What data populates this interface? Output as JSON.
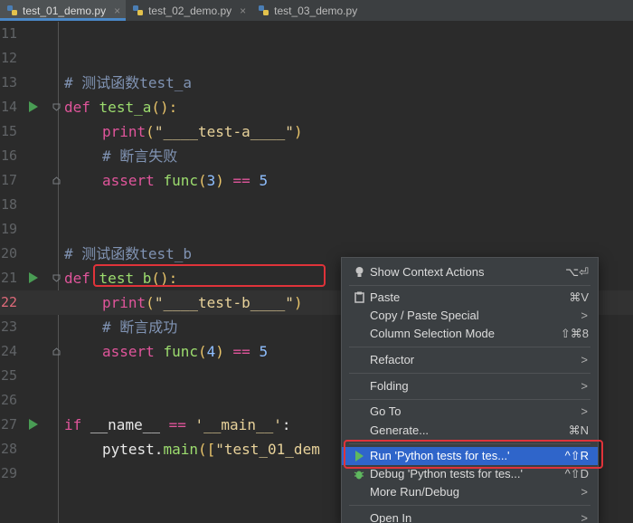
{
  "tabs": [
    {
      "label": "test_01_demo.py",
      "active": true
    },
    {
      "label": "test_02_demo.py",
      "active": false
    },
    {
      "label": "test_03_demo.py",
      "active": false
    }
  ],
  "tab_close_glyph": "×",
  "lines": [
    {
      "num": "11"
    },
    {
      "num": "12"
    },
    {
      "num": "13",
      "comment": "# 测试函数test_a"
    },
    {
      "num": "14",
      "kw": "def",
      "name": "test_a",
      "tail": "():"
    },
    {
      "num": "15",
      "call": "print",
      "open": "(",
      "str": "\"____test-a____\"",
      "close": ")"
    },
    {
      "num": "16",
      "comment": "# 断言失败"
    },
    {
      "num": "17",
      "assert": "assert",
      "fn": "func",
      "open": "(",
      "arg": "3",
      "close": ")",
      "op": "==",
      "rhs": "5"
    },
    {
      "num": "18"
    },
    {
      "num": "19"
    },
    {
      "num": "20",
      "comment": "# 测试函数test_b"
    },
    {
      "num": "21",
      "kw": "def",
      "name": "test_b",
      "tail": "():"
    },
    {
      "num": "22",
      "call": "print",
      "open": "(",
      "str": "\"____test-b____\"",
      "close": ")"
    },
    {
      "num": "23",
      "comment": "# 断言成功"
    },
    {
      "num": "24",
      "assert": "assert",
      "fn": "func",
      "open": "(",
      "arg": "4",
      "close": ")",
      "op": "==",
      "rhs": "5"
    },
    {
      "num": "25"
    },
    {
      "num": "26"
    },
    {
      "num": "27",
      "if": "if",
      "dname": "__name__",
      "op": "==",
      "str": "'__main__'",
      "colon": ":"
    },
    {
      "num": "28",
      "mod": "pytest",
      "dot": ".",
      "meth": "main",
      "open": "([",
      "str": "\"test_01_dem"
    },
    {
      "num": "29"
    }
  ],
  "context_menu": {
    "items": [
      {
        "label": "Show Context Actions",
        "shortcut": "⌥⏎",
        "icon": "lightbulb-icon"
      },
      {
        "label": "Paste",
        "shortcut": "⌘V",
        "icon": "clipboard-icon"
      },
      {
        "label": "Copy / Paste Special",
        "shortcut": ">"
      },
      {
        "label": "Column Selection Mode",
        "shortcut": "⇧⌘8"
      },
      {
        "label": "Refactor",
        "shortcut": ">"
      },
      {
        "label": "Folding",
        "shortcut": ">"
      },
      {
        "label": "Go To",
        "shortcut": ">"
      },
      {
        "label": "Generate...",
        "shortcut": "⌘N"
      },
      {
        "label": "Run 'Python tests for tes...'",
        "shortcut": "^⇧R",
        "icon": "run-icon",
        "selected": true
      },
      {
        "label": "Debug 'Python tests for tes...'",
        "shortcut": "^⇧D",
        "icon": "debug-icon"
      },
      {
        "label": "More Run/Debug",
        "shortcut": ">"
      },
      {
        "label": "Open In",
        "shortcut": ">"
      }
    ]
  },
  "colors": {
    "editor_bg": "#2b2b2b",
    "menu_selected": "#2f65ca",
    "annotation_box": "#e0333a",
    "run_arrow": "#499c54"
  }
}
